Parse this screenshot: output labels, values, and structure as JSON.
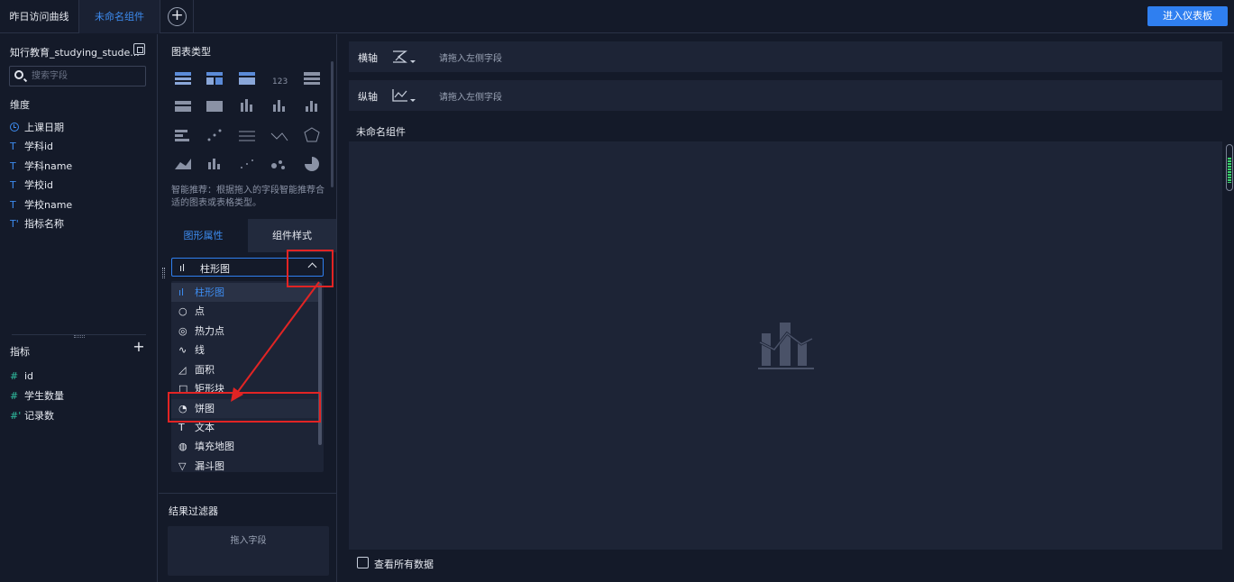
{
  "topbar": {
    "tabs": [
      "昨日访问曲线",
      "未命名组件"
    ],
    "add_tab": "+",
    "enter_dashboard": "进入仪表板"
  },
  "left": {
    "dataset_title": "知行教育_studying_stude...",
    "search_placeholder": "搜索字段",
    "dimensions_label": "维度",
    "dimensions": [
      {
        "type": "date",
        "name": "上课日期"
      },
      {
        "type": "T",
        "name": "学科id"
      },
      {
        "type": "T",
        "name": "学科name"
      },
      {
        "type": "T",
        "name": "学校id"
      },
      {
        "type": "T",
        "name": "学校name"
      },
      {
        "type": "T'",
        "name": "指标名称"
      }
    ],
    "measures_label": "指标",
    "measures": [
      {
        "type": "#",
        "name": "id"
      },
      {
        "type": "#",
        "name": "学生数量"
      },
      {
        "type": "#'",
        "name": "记录数"
      }
    ]
  },
  "middle": {
    "chart_types_title": "图表类型",
    "recommend_text": "智能推荐：根据拖入的字段智能推荐合适的图表或表格类型。",
    "tab_graph_props": "图形属性",
    "tab_component_style": "组件样式",
    "selected_chart": "柱形图",
    "dropdown_items": [
      {
        "icon": "bar-chart-icon",
        "glyph": "ıl",
        "label": "柱形图"
      },
      {
        "icon": "point-icon",
        "glyph": "○",
        "label": "点"
      },
      {
        "icon": "heat-point-icon",
        "glyph": "◎",
        "label": "热力点"
      },
      {
        "icon": "line-icon",
        "glyph": "∿",
        "label": "线"
      },
      {
        "icon": "area-icon",
        "glyph": "◿",
        "label": "面积"
      },
      {
        "icon": "rect-block-icon",
        "glyph": "□",
        "label": "矩形块"
      },
      {
        "icon": "pie-icon",
        "glyph": "◔",
        "label": "饼图"
      },
      {
        "icon": "text-icon",
        "glyph": "T",
        "label": "文本"
      },
      {
        "icon": "fill-map-icon",
        "glyph": "◍",
        "label": "填充地图"
      },
      {
        "icon": "funnel-icon",
        "glyph": "▽",
        "label": "漏斗图"
      }
    ],
    "filter_title": "结果过滤器",
    "filter_drop": "拖入字段"
  },
  "right": {
    "x_axis_label": "横轴",
    "y_axis_label": "纵轴",
    "axis_placeholder": "请拖入左侧字段",
    "component_title": "未命名组件",
    "view_all_data": "查看所有数据"
  },
  "colors": {
    "background": "#141a29",
    "panel": "#1d2436",
    "accent": "#2f7ff0",
    "annotation_red": "#e22424"
  }
}
